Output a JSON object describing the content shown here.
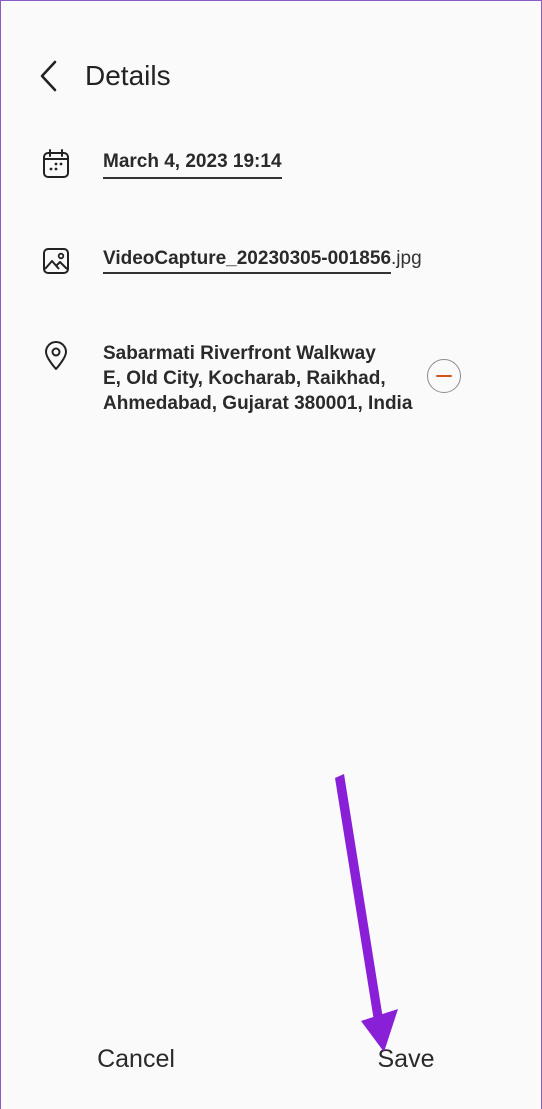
{
  "header": {
    "title": "Details",
    "back_icon": "chevron-left-icon"
  },
  "details": {
    "date": {
      "icon": "calendar-icon",
      "value": "March 4, 2023 19:14"
    },
    "file": {
      "icon": "image-icon",
      "base_name": "VideoCapture_20230305-001856",
      "extension": ".jpg"
    },
    "location": {
      "icon": "location-pin-icon",
      "value": "Sabarmati Riverfront Walkway\nE, Old City, Kocharab, Raikhad,\nAhmedabad, Gujarat 380001, India",
      "remove_icon": "minus-circle-icon"
    }
  },
  "footer": {
    "cancel_label": "Cancel",
    "save_label": "Save"
  },
  "colors": {
    "remove_accent": "#d2541e",
    "annotation_arrow": "#8a1fd8",
    "background": "#fafafa"
  }
}
